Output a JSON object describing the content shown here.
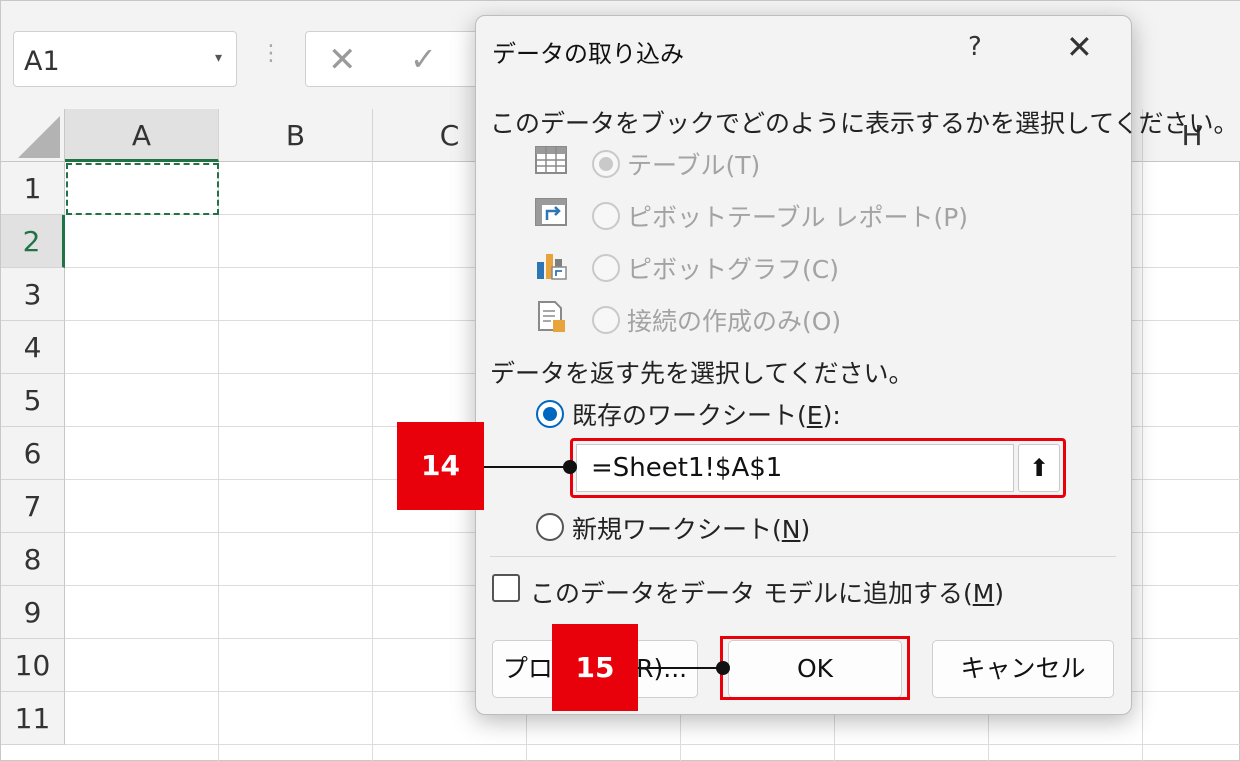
{
  "excel": {
    "namebox_value": "A1",
    "namebox_arrow": "▾",
    "fx_dots": "⋮",
    "fx_cancel": "✕",
    "fx_enter": "✓",
    "columns": [
      "A",
      "B",
      "C",
      "H"
    ],
    "rows": [
      "1",
      "2",
      "3",
      "4",
      "5",
      "6",
      "7",
      "8",
      "9",
      "10",
      "11"
    ],
    "selected_column": "A",
    "selected_row": "2"
  },
  "dialog": {
    "title": "データの取り込み",
    "help": "?",
    "close": "✕",
    "question_display": "このデータをブックでどのように表示するかを選択してください。",
    "options": [
      {
        "label": "テーブル(T)",
        "icon": "table-icon",
        "state": "checked-disabled"
      },
      {
        "label": "ピボットテーブル レポート(P)",
        "icon": "pivot-table-icon",
        "state": "disabled"
      },
      {
        "label": "ピボットグラフ(C)",
        "icon": "pivot-chart-icon",
        "state": "disabled"
      },
      {
        "label": "接続の作成のみ(O)",
        "icon": "connection-only-icon",
        "state": "disabled"
      }
    ],
    "question_destination": "データを返す先を選択してください。",
    "existing_sheet": {
      "prefix": "既存のワークシート(",
      "accel": "E",
      "suffix": "):"
    },
    "reference_value": "=Sheet1!$A$1",
    "collapse_icon": "⬆",
    "new_sheet": {
      "prefix": "新規ワークシート(",
      "accel": "N",
      "suffix": ")"
    },
    "data_model": {
      "prefix": "このデータをデータ モデルに追加する(",
      "accel": "M",
      "suffix": ")"
    },
    "buttons": {
      "properties": "プロパティ(R)...",
      "ok": "OK",
      "cancel": "キャンセル"
    }
  },
  "annotations": [
    {
      "number": "14",
      "target": "reference-input"
    },
    {
      "number": "15",
      "target": "ok-button"
    }
  ],
  "colors": {
    "accent": "#0067c0",
    "highlight": "#e8000b",
    "excel_green": "#217346"
  }
}
